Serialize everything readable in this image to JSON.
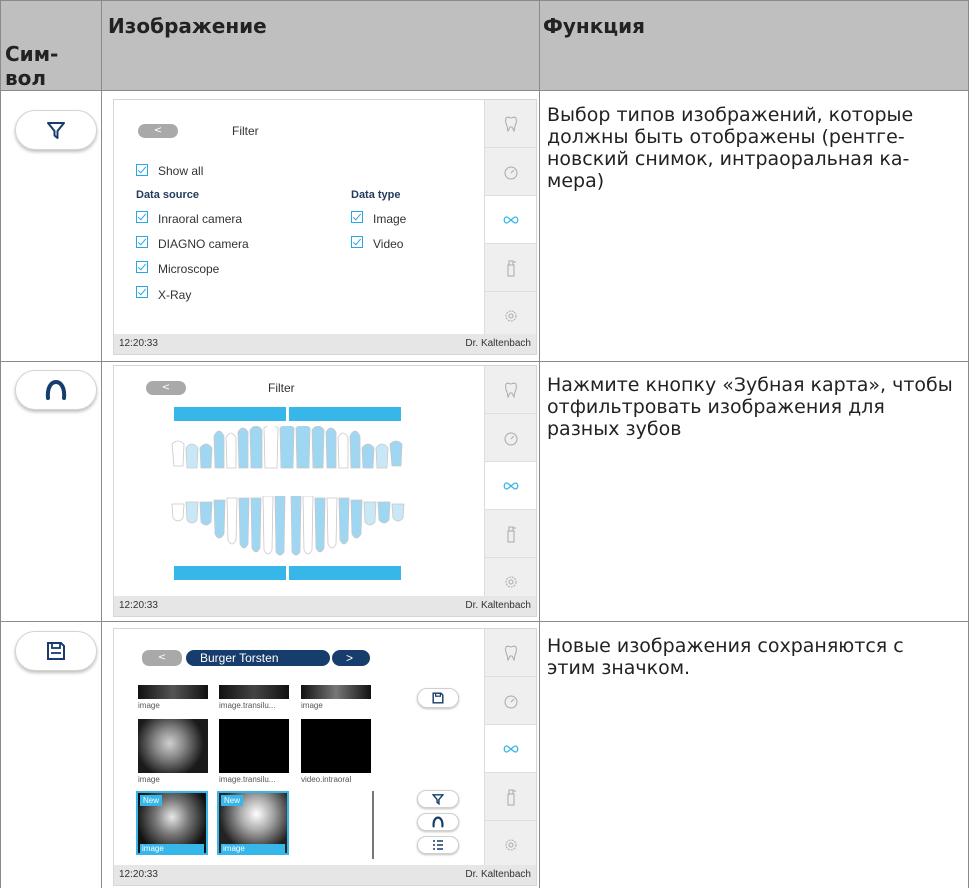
{
  "header": {
    "symbol_col": "Сим-\nвол",
    "image_col": "Изображение",
    "function_col": "Функция"
  },
  "rows": [
    {
      "symbol_icon": "filter-icon",
      "function_text": "Выбор типов изображений, которые должны быть отображены (рентге-новский снимок, интраоральная ка-мера)"
    },
    {
      "symbol_icon": "dental-arch-icon",
      "function_text": "Нажмите кнопку «Зубная карта», чтобы отфильтровать изображения для разных зубов"
    },
    {
      "symbol_icon": "save-icon",
      "function_text": "Новые изображения сохраняются с этим значком."
    }
  ],
  "screens": {
    "status_time": "12:20:33",
    "status_user": "Dr. Kaltenbach",
    "back_label": "<",
    "sidebar_icons": [
      "tooth-icon",
      "timer-icon",
      "infinity-icon",
      "spray-icon",
      "settings-icon"
    ],
    "accent_color": "#37b6ea",
    "filter_screen": {
      "title": "Filter",
      "show_all": "Show all",
      "data_source_heading": "Data source",
      "data_type_heading": "Data type",
      "sources": [
        "Inraoral camera",
        "DIAGNO camera",
        "Microscope",
        "X-Ray"
      ],
      "types": [
        "Image",
        "Video"
      ]
    },
    "tooth_screen": {
      "title": "Filter"
    },
    "gallery_screen": {
      "patient_name": "Burger Torsten",
      "next_label": ">",
      "new_badge": "New",
      "labels_row1": [
        "image",
        "image.transilu...",
        "image"
      ],
      "labels_row2": [
        "image",
        "image.transilu...",
        "video.intraoral"
      ],
      "labels_row3": [
        "image",
        "image"
      ]
    }
  }
}
